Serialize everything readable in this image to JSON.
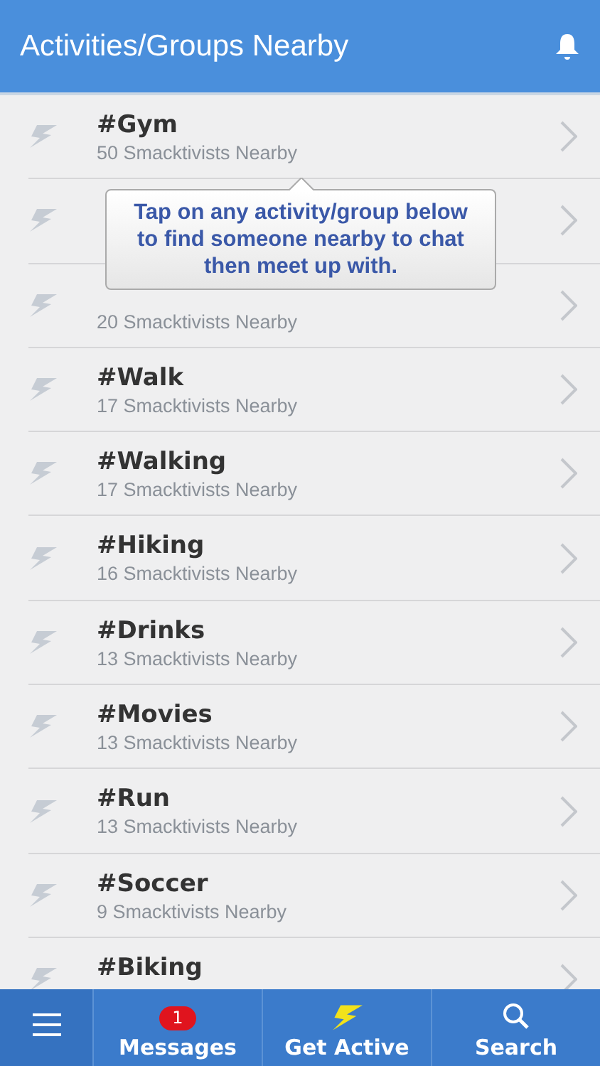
{
  "header": {
    "title": "Activities/Groups Nearby"
  },
  "tooltip": {
    "text": "Tap on any activity/group below to find someone nearby to chat then meet up with."
  },
  "activities": [
    {
      "kind": "activity",
      "title": "#Gym",
      "subtitle": "50 Smacktivists Nearby"
    },
    {
      "kind": "covered"
    },
    {
      "kind": "activity",
      "subtitle": "20 Smacktivists Nearby"
    },
    {
      "kind": "activity",
      "title": "#Walk",
      "subtitle": "17 Smacktivists Nearby"
    },
    {
      "kind": "activity",
      "title": "#Walking",
      "subtitle": "17 Smacktivists Nearby"
    },
    {
      "kind": "activity",
      "title": "#Hiking",
      "subtitle": "16 Smacktivists Nearby"
    },
    {
      "kind": "activity",
      "title": "#Drinks",
      "subtitle": "13 Smacktivists Nearby"
    },
    {
      "kind": "activity",
      "title": "#Movies",
      "subtitle": "13 Smacktivists Nearby"
    },
    {
      "kind": "activity",
      "title": "#Run",
      "subtitle": "13 Smacktivists Nearby"
    },
    {
      "kind": "activity",
      "title": "#Soccer",
      "subtitle": "9 Smacktivists Nearby"
    },
    {
      "kind": "activity",
      "title": "#Biking"
    }
  ],
  "tab_bar": [
    {
      "kind": "menu"
    },
    {
      "kind": "messages",
      "label": "Messages",
      "badge": "1"
    },
    {
      "kind": "active",
      "label": "Get Active"
    },
    {
      "kind": "search",
      "label": "Search"
    }
  ]
}
